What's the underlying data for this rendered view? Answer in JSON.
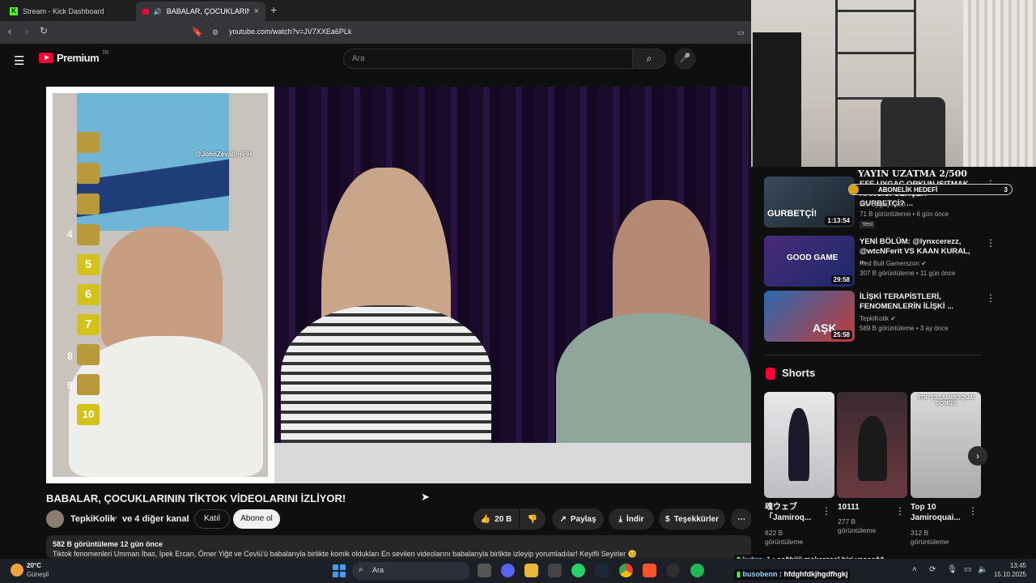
{
  "browser": {
    "tabs": [
      {
        "label": "Stream - Kick Dashboard",
        "active": false
      },
      {
        "label": "BABALAR, ÇOCUKLARININ TİK",
        "active": true
      }
    ],
    "url": "youtube.com/watch?v=JV7XXEa6PLk"
  },
  "header": {
    "logo": "Premium",
    "logo_region": "TR",
    "search_placeholder": "Ara"
  },
  "video": {
    "title": "BABALAR, ÇOCUKLARININ TİKTOK VİDEOLARINI İZLİYOR!",
    "overlay_watermark": "@JohnZevallosPH",
    "ranks": [
      "4",
      "5",
      "6",
      "7",
      "8",
      "9",
      "10"
    ],
    "channel": "TepkiKolik",
    "channel_more": "ve 4 diğer kanal",
    "join_label": "Katıl",
    "subscribe_label": "Abone ol",
    "likes": "20 B",
    "share_label": "Paylaş",
    "download_label": "İndir",
    "thanks_label": "Teşekkürler",
    "description_stats": "582 B görüntüleme  12 gün önce",
    "description_line": "Tiktok fenomenleri Umman İbas, İpek Ercan, Ömer Yiğit ve Cevlü'ü babalarıyla birlikte komik oldukları En sevilen videolarını babalarıyla birlikte izleyip yorumladılar! Keyifli Seyirler 😊"
  },
  "stream_overlay": {
    "title": "YAYIN UZATMA 2/500",
    "goal_label": "ABONELİK HEDEFİ",
    "goal_count": "3",
    "goal_progress": 0.06
  },
  "recommendations": [
    {
      "title": "EFE UYGAÇ ORKUN IŞITMAK HANGİSİ GERÇEK GURBETÇİ? ...",
      "channel": "Efe Uygaç Kesit",
      "meta": "71 B görüntüleme • 6 gün önce",
      "badge": "Yeni",
      "duration": "1:13:54",
      "thumb_text": "GURBETÇİ!",
      "verified": false
    },
    {
      "title": "YENİ BÖLÜM: @lynxcerezz, @wtcNFerit VS KAAN KURAL, ...",
      "channel": "Red Bull Gamerszon",
      "meta": "307 B görüntüleme • 11 gün önce",
      "badge": "",
      "duration": "29:58",
      "thumb_text": "GOOD GAME",
      "verified": true
    },
    {
      "title": "İLİŞKİ TERAPİSTLERİ, FENOMENLERİN İLİŞKİ ...",
      "channel": "TepkiKolik",
      "meta": "589 B görüntüleme • 3 ay önce",
      "badge": "",
      "duration": "25:58",
      "thumb_text": "AŞK",
      "verified": true
    }
  ],
  "shorts": {
    "heading": "Shorts",
    "items": [
      {
        "title": "魂ウェブ「Jamiroq...",
        "views": "622 B görüntüleme",
        "thumb_text": ""
      },
      {
        "title": "10111",
        "views": "277 B görüntüleme",
        "thumb_text": ""
      },
      {
        "title": "Top 10 Jamiroquai...",
        "views": "312 B görüntüleme",
        "thumb_text": "TOP 10 JAMIROQUAI SONGS"
      }
    ]
  },
  "chat": [
    {
      "user": "kubra_1",
      "message": "aağbiiii makarasal biri yaaaağğ"
    },
    {
      "user": "busobenn",
      "message": "hfdghfdkjhgdfhgkj"
    }
  ],
  "taskbar": {
    "weather_temp": "20°C",
    "weather_desc": "Güneşli",
    "search_placeholder": "Ara",
    "time": "13:45",
    "date": "15.10.2025"
  },
  "colors": {
    "accent": "#ff0033",
    "kick": "#53fc18",
    "goal": "#e0a000"
  }
}
